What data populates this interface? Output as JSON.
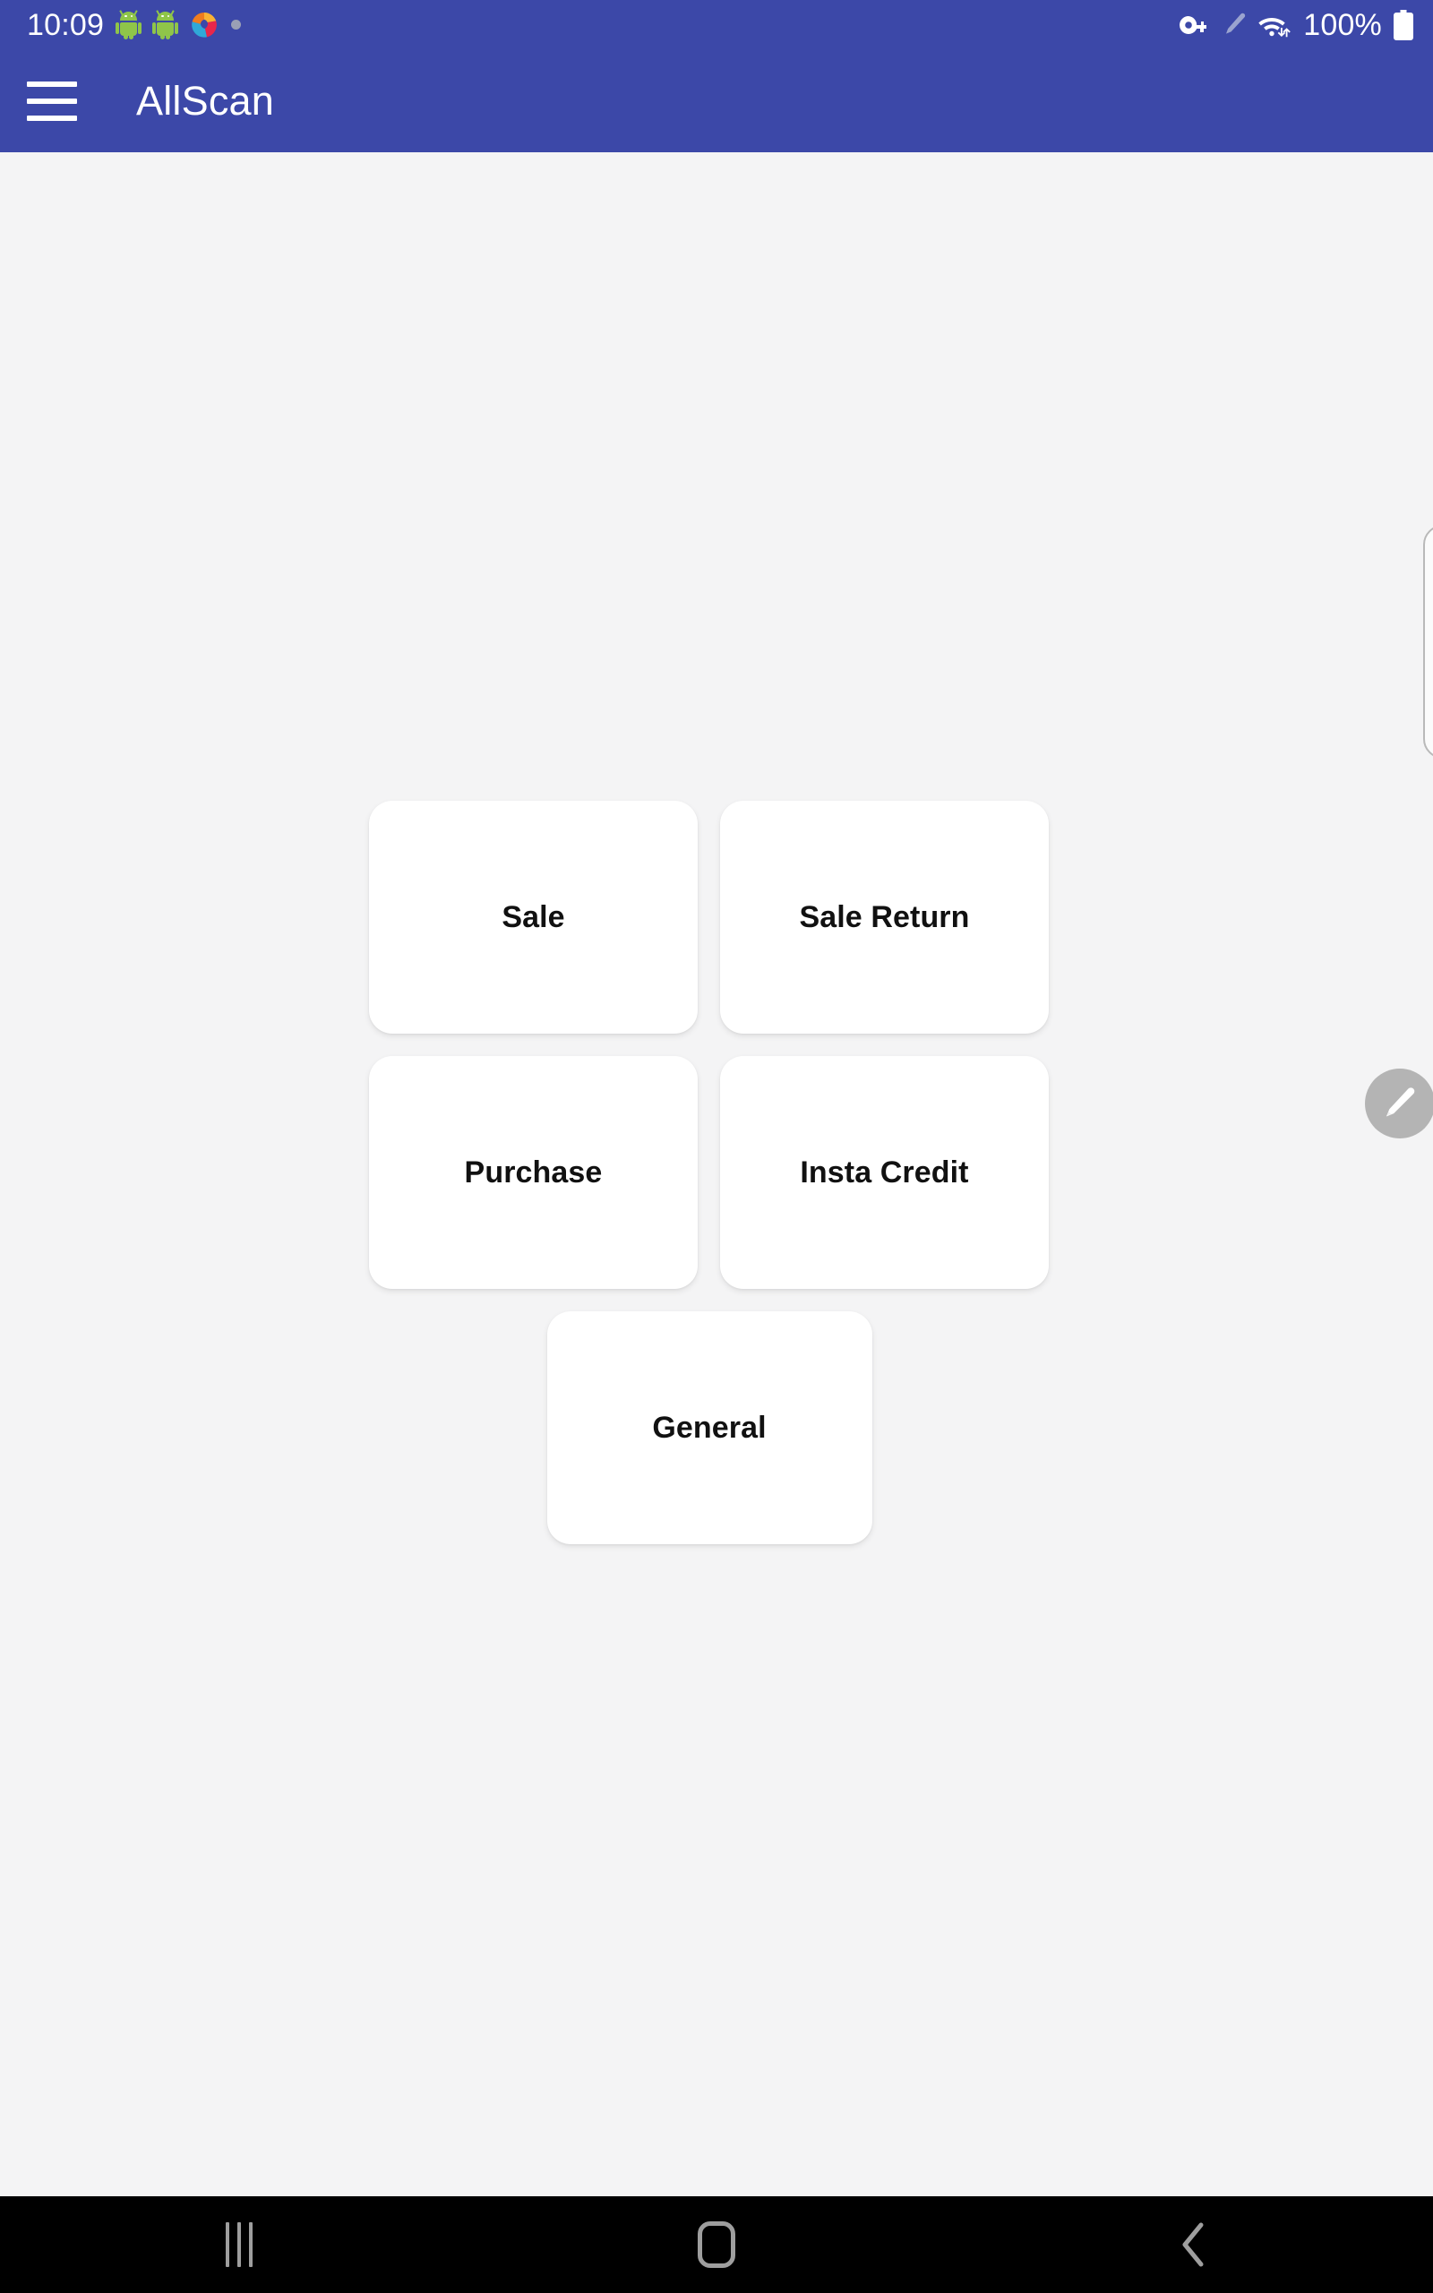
{
  "status_bar": {
    "clock": "10:09",
    "battery_percent": "100%",
    "left_icons": [
      {
        "name": "android-app-icon-1",
        "label": "android"
      },
      {
        "name": "android-app-icon-2",
        "label": "android"
      },
      {
        "name": "browser-swirl-icon",
        "label": "browser"
      },
      {
        "name": "notification-dot-icon",
        "label": "notification"
      }
    ],
    "right_icons": [
      {
        "name": "vpn-key-icon",
        "label": "vpn key"
      },
      {
        "name": "pencil-icon",
        "label": "edit"
      },
      {
        "name": "wifi-transfer-icon",
        "label": "wifi"
      },
      {
        "name": "battery-icon",
        "label": "battery full"
      }
    ]
  },
  "app_bar": {
    "title": "AllScan",
    "menu_icon": "hamburger-menu-icon"
  },
  "fab": {
    "icon": "pencil-edit-icon",
    "color": "#b4b4b4"
  },
  "main": {
    "rows": [
      [
        {
          "label": "Sale",
          "name": "sale"
        },
        {
          "label": "Sale Return",
          "name": "sale-return"
        }
      ],
      [
        {
          "label": "Purchase",
          "name": "purchase"
        },
        {
          "label": "Insta Credit",
          "name": "insta-credit"
        }
      ],
      [
        {
          "label": "General",
          "name": "general"
        }
      ]
    ]
  },
  "nav_bar": {
    "recents_label": "Recents",
    "home_label": "Home",
    "back_label": "Back"
  },
  "colors": {
    "app_bar": "#3c48a8",
    "background": "#f4f4f5",
    "card": "#ffffff",
    "nav_bar": "#000000",
    "nav_icon": "#9e9e9e"
  }
}
